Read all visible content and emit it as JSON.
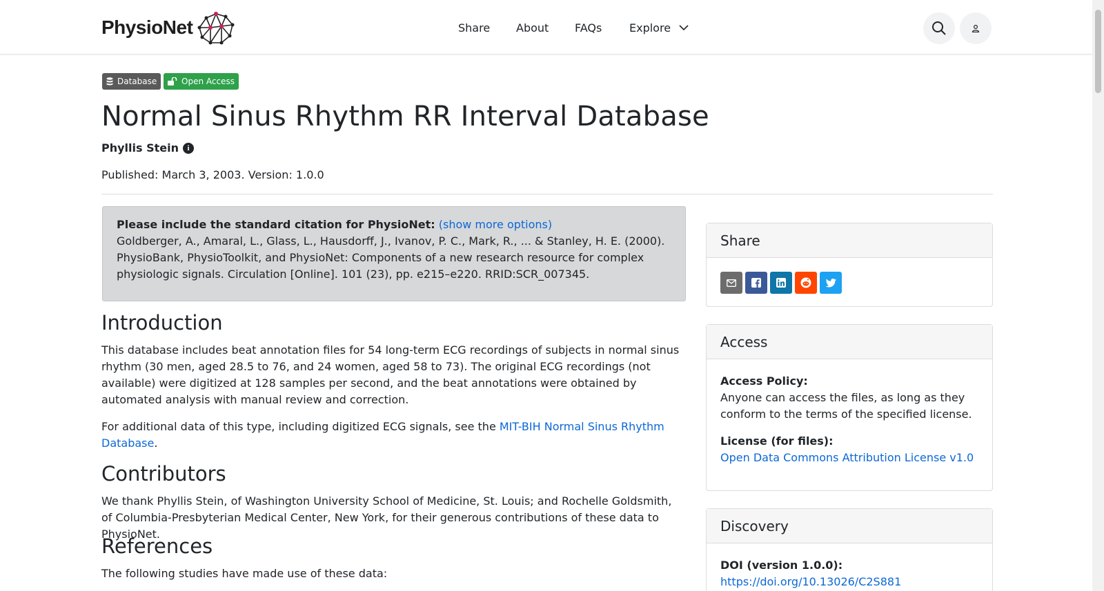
{
  "header": {
    "logo_text": "PhysioNet",
    "nav": {
      "share": "Share",
      "about": "About",
      "faqs": "FAQs",
      "explore": "Explore"
    }
  },
  "badges": {
    "database": "Database",
    "open_access": "Open Access"
  },
  "title": "Normal Sinus Rhythm RR Interval Database",
  "author": "Phyllis Stein",
  "published": "Published: March 3, 2003. Version: 1.0.0",
  "citation": {
    "lead": "Please include the standard citation for PhysioNet:",
    "more_link": "(show more options)",
    "text": "Goldberger, A., Amaral, L., Glass, L., Hausdorff, J., Ivanov, P. C., Mark, R., ... & Stanley, H. E. (2000). PhysioBank, PhysioToolkit, and PhysioNet: Components of a new research resource for complex physiologic signals. Circulation [Online]. 101 (23), pp. e215–e220. RRID:SCR_007345."
  },
  "introduction": {
    "heading": "Introduction",
    "p1": "This database includes beat annotation files for 54 long-term ECG recordings of subjects in normal sinus rhythm (30 men, aged 28.5 to 76, and 24 women, aged 58 to 73). The original ECG recordings (not available) were digitized at 128 samples per second, and the beat annotations were obtained by automated analysis with manual review and correction.",
    "p2_before": "For additional data of this type, including digitized ECG signals, see the ",
    "p2_link": "MIT-BIH Normal Sinus Rhythm Database",
    "p2_after": "."
  },
  "contributors": {
    "heading": "Contributors",
    "text": "We thank Phyllis Stein, of Washington University School of Medicine, St. Louis; and Rochelle Goldsmith, of Columbia-Presbyterian Medical Center, New York, for their generous contributions of these data to PhysioNet."
  },
  "references": {
    "heading": "References",
    "text": "The following studies have made use of these data:"
  },
  "sidebar": {
    "share": {
      "title": "Share",
      "colors": {
        "email": "#6c6c6c",
        "facebook": "#3b5998",
        "linkedin": "#0e76a8",
        "reddit": "#ff4500",
        "twitter": "#1da1f2"
      }
    },
    "access": {
      "title": "Access",
      "policy_label": "Access Policy:",
      "policy_text": "Anyone can access the files, as long as they conform to the terms of the specified license.",
      "license_label": "License (for files):",
      "license_link": "Open Data Commons Attribution License v1.0"
    },
    "discovery": {
      "title": "Discovery",
      "doi_label": "DOI (version 1.0.0):",
      "doi_link": "https://doi.org/10.13026/C2S881"
    }
  }
}
